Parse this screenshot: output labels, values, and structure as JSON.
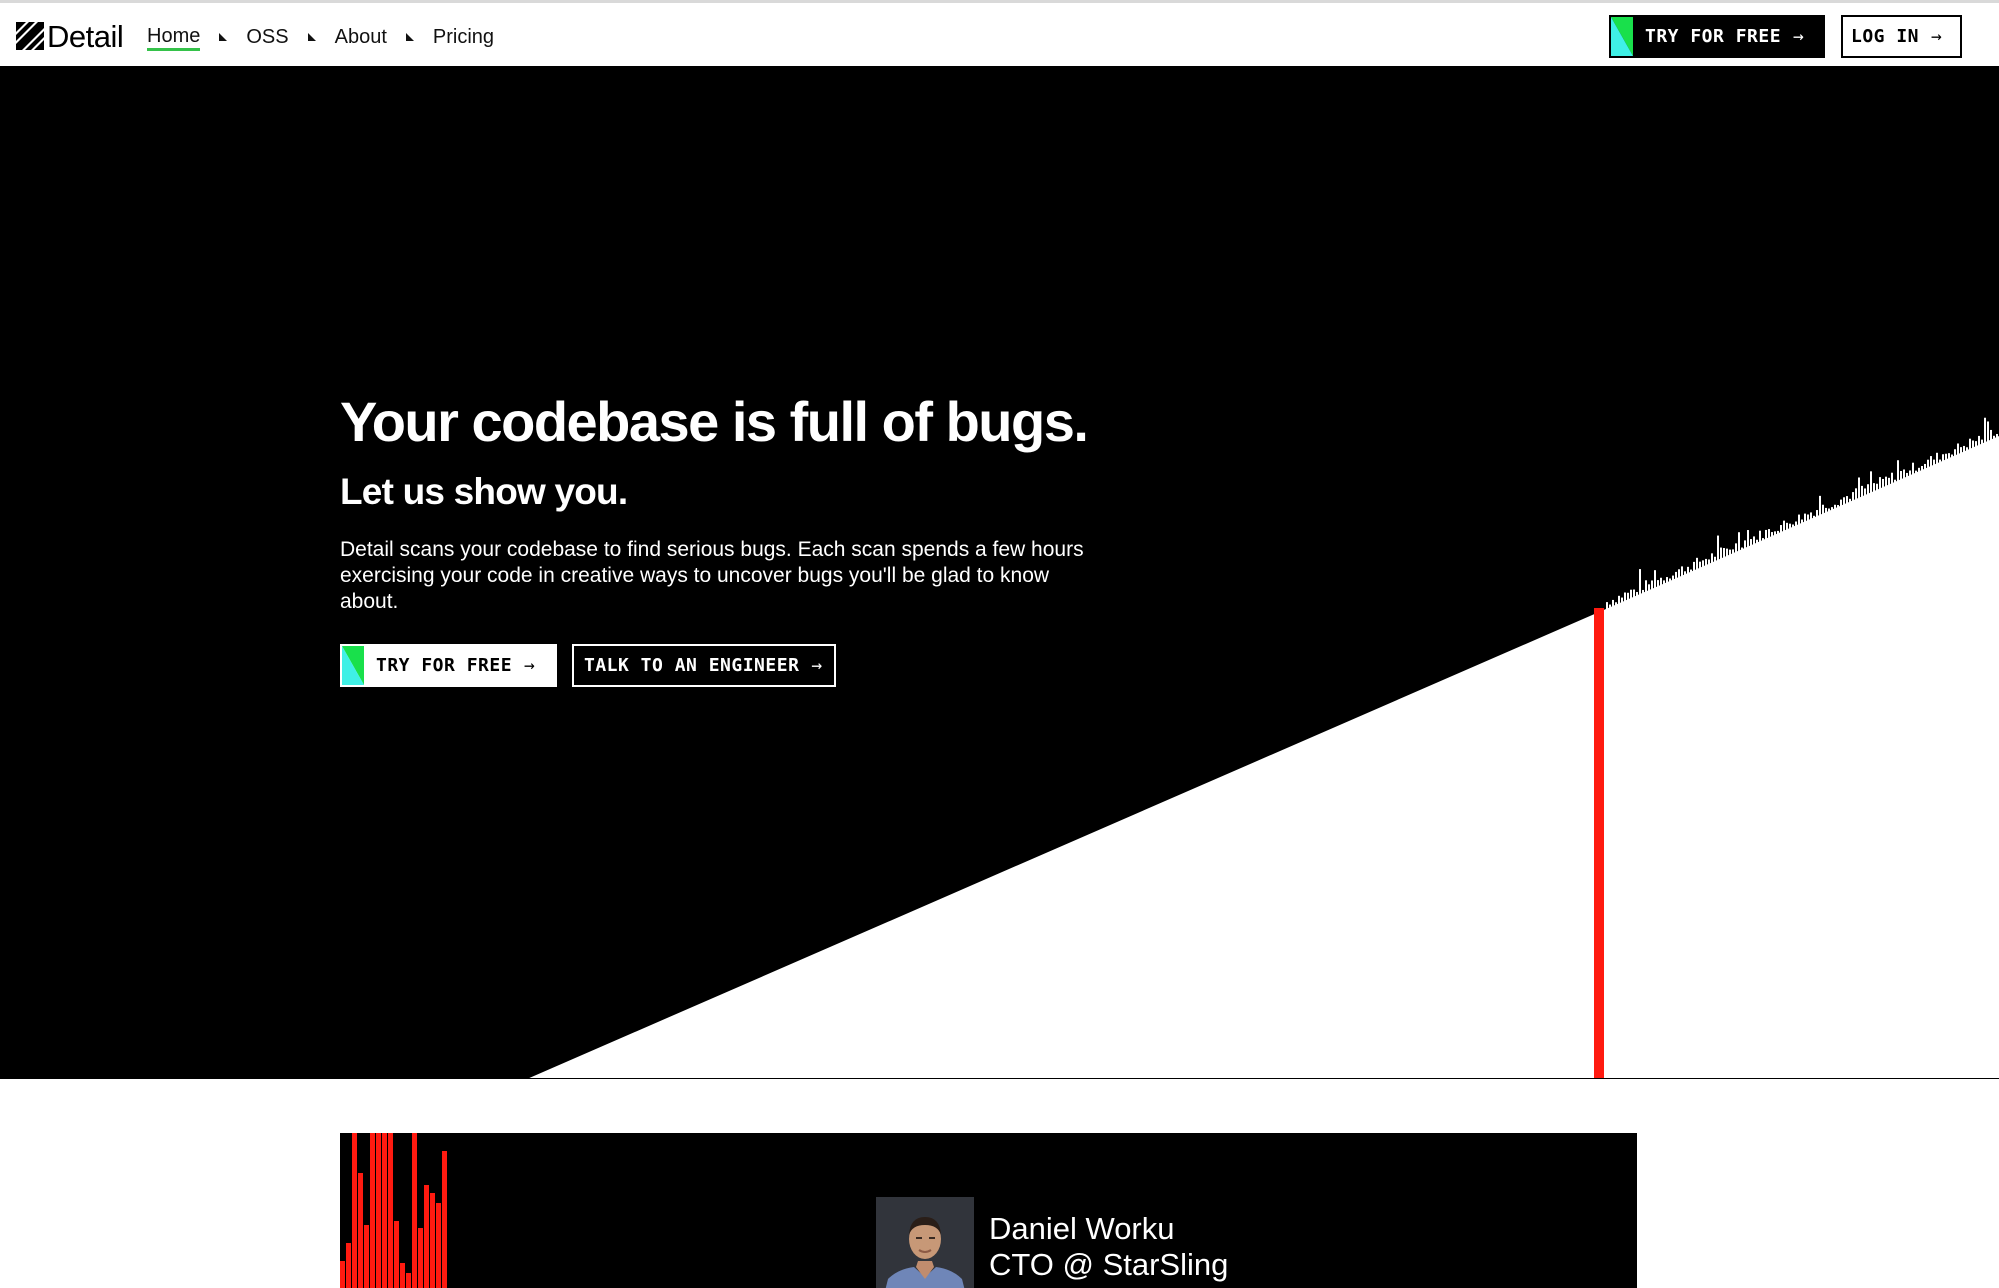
{
  "nav": {
    "logo_text": "Detail",
    "links": [
      {
        "label": "Home",
        "active": true
      },
      {
        "label": "OSS",
        "active": false
      },
      {
        "label": "About",
        "active": false
      },
      {
        "label": "Pricing",
        "active": false
      }
    ],
    "try_label": "TRY FOR FREE",
    "login_label": "LOG IN",
    "arrow": "→"
  },
  "hero": {
    "title": "Your codebase is full of bugs.",
    "subtitle": "Let us show you.",
    "body": "Detail scans your codebase to find serious bugs. Each scan spends a few hours exercising your code in creative ways to uncover bugs you'll be glad to know about.",
    "try_label": "TRY FOR FREE",
    "talk_label": "TALK TO AN ENGINEER",
    "arrow": "→"
  },
  "testimonial": {
    "name": "Daniel Worku",
    "role": "CTO @ StarSling"
  },
  "colors": {
    "accent_green": "#35c24a",
    "gradient_green": "#19e04b",
    "gradient_cyan": "#3ff0e6",
    "highlight_red": "#ff1a10",
    "background_dark": "#000000"
  },
  "icons": [
    "logo-mark-icon",
    "nav-separator-icon",
    "arrow-right-icon"
  ]
}
